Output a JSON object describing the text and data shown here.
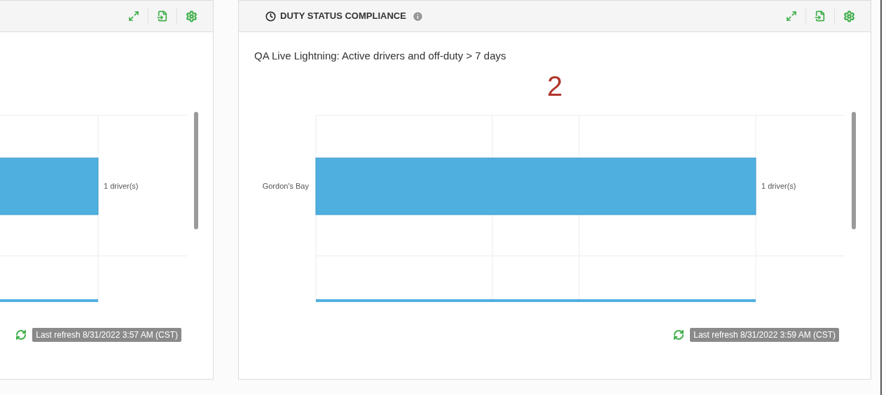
{
  "panels": [
    {
      "refresh": "Last refresh 8/31/2022 3:57 AM (CST)",
      "bar_rows": [
        {
          "reading": "1 driver(s)"
        }
      ]
    },
    {
      "header": {
        "title": "DUTY STATUS COMPLIANCE"
      },
      "subtitle": "QA Live Lightning: Active drivers and off-duty > 7 days",
      "count": "2",
      "refresh": "Last refresh 8/31/2022 3:59 AM (CST)",
      "bar_rows": [
        {
          "category": "Gordon's Bay",
          "reading": "1 driver(s)"
        }
      ]
    }
  ]
}
